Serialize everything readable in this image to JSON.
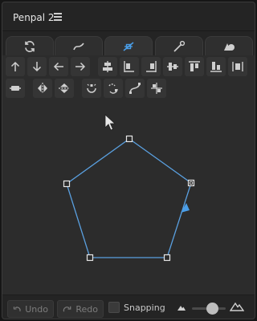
{
  "window": {
    "title": "Penpal 2",
    "menu_icon": "hamburger-menu-icon"
  },
  "tabs": [
    {
      "name": "sync",
      "icon": "rotate-arrows-icon",
      "active": false
    },
    {
      "name": "curve",
      "icon": "curve-tool-icon",
      "active": false
    },
    {
      "name": "node",
      "icon": "node-tool-icon",
      "active": true
    },
    {
      "name": "pen",
      "icon": "pen-tool-icon",
      "active": false
    },
    {
      "name": "shapes",
      "icon": "shapes-icon",
      "active": false
    }
  ],
  "toolbar_row1": [
    "arrow-up-icon",
    "arrow-down-icon",
    "arrow-left-icon",
    "arrow-right-icon",
    "align-center-horizontal-icon",
    "align-left-icon",
    "align-right-icon",
    "align-middle-icon",
    "align-top-icon",
    "align-bottom-icon",
    "distribute-vertical-icon"
  ],
  "toolbar_row2": [
    "distribute-horizontal-icon",
    "flip-horizontal-icon",
    "flip-vertical-icon",
    "smooth-node-icon",
    "break-path-icon",
    "curve-segment-icon",
    "join-nodes-icon"
  ],
  "bottom": {
    "undo_label": "Undo",
    "redo_label": "Redo",
    "snapping_label": "Snapping",
    "snapping_checked": false,
    "zoom_level": 0.55
  },
  "colors": {
    "accent": "#4a9ee8",
    "path": "#5aa0e0",
    "node": "#e6e6e6"
  }
}
